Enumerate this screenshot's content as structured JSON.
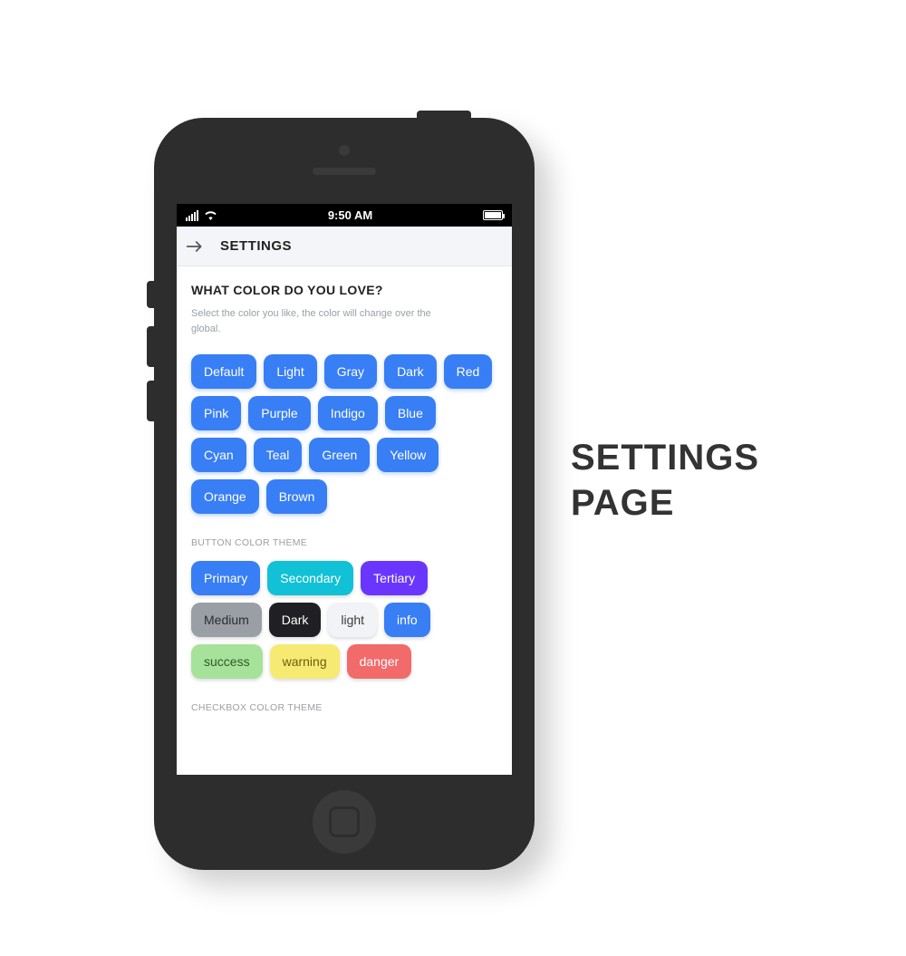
{
  "caption": {
    "line1": "SETTINGS",
    "line2": "PAGE"
  },
  "status_bar": {
    "time": "9:50 AM"
  },
  "header": {
    "title": "SETTINGS"
  },
  "section_colors": {
    "title": "WHAT COLOR DO YOU LOVE?",
    "subtitle": "Select the color you like, the color will change over the global.",
    "buttons": [
      {
        "label": "Default"
      },
      {
        "label": "Light"
      },
      {
        "label": "Gray"
      },
      {
        "label": "Dark"
      },
      {
        "label": "Red"
      },
      {
        "label": "Pink"
      },
      {
        "label": "Purple"
      },
      {
        "label": "Indigo"
      },
      {
        "label": "Blue"
      },
      {
        "label": "Cyan"
      },
      {
        "label": "Teal"
      },
      {
        "label": "Green"
      },
      {
        "label": "Yellow"
      },
      {
        "label": "Orange"
      },
      {
        "label": "Brown"
      }
    ]
  },
  "section_button_theme": {
    "label": "BUTTON COLOR THEME",
    "buttons": [
      {
        "label": "Primary",
        "bg": "#387ef5",
        "fg": "#ffffff"
      },
      {
        "label": "Secondary",
        "bg": "#11c1d6",
        "fg": "#ffffff"
      },
      {
        "label": "Tertiary",
        "bg": "#6a36ff",
        "fg": "#ffffff"
      },
      {
        "label": "Medium",
        "bg": "#9a9fa6",
        "fg": "#2d2d2d"
      },
      {
        "label": "Dark",
        "bg": "#1f1f24",
        "fg": "#ffffff"
      },
      {
        "label": "light",
        "bg": "#f1f3f6",
        "fg": "#3c3c3c"
      },
      {
        "label": "info",
        "bg": "#387ef5",
        "fg": "#ffffff"
      },
      {
        "label": "success",
        "bg": "#a7e29b",
        "fg": "#2d5a23"
      },
      {
        "label": "warning",
        "bg": "#f7ea73",
        "fg": "#6b5e12"
      },
      {
        "label": "danger",
        "bg": "#f26a6a",
        "fg": "#ffffff"
      }
    ]
  },
  "section_checkbox_theme": {
    "label": "CHECKBOX COLOR THEME"
  }
}
